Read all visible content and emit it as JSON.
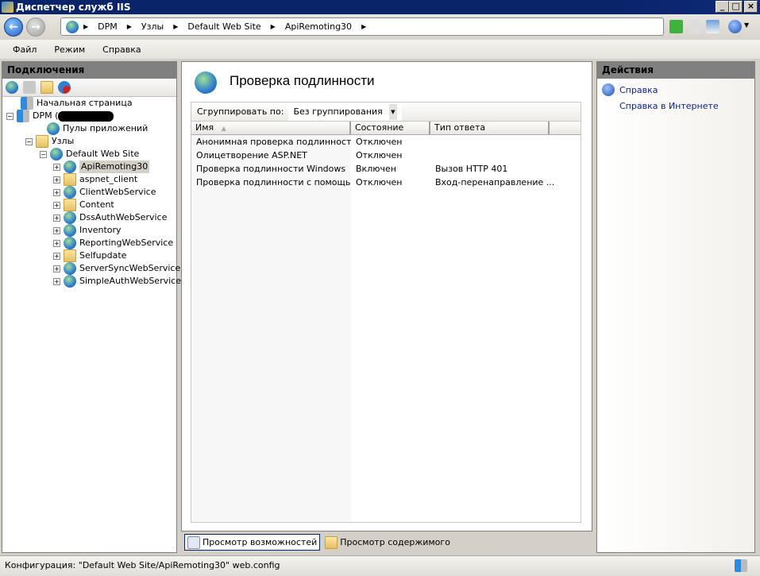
{
  "window": {
    "title": "Диспетчер служб IIS",
    "min": "_",
    "max": "□",
    "close": "×"
  },
  "address": {
    "crumbs": [
      "DPM",
      "Узлы",
      "Default Web Site",
      "ApiRemoting30"
    ],
    "sep": "▶"
  },
  "menu": [
    "Файл",
    "Режим",
    "Справка"
  ],
  "connections": {
    "title": "Подключения",
    "tree": [
      {
        "label": "Начальная страница",
        "icon": "home-server-icon"
      },
      {
        "label": "DPM (",
        "icon": "server-icon"
      },
      {
        "label": "Пулы приложений",
        "icon": "app-pools-icon"
      },
      {
        "label": "Узлы",
        "icon": "sites-folder-icon"
      },
      {
        "label": "Default Web Site",
        "icon": "globe-icon"
      },
      {
        "label": "ApiRemoting30",
        "icon": "web-app-icon"
      },
      {
        "label": "aspnet_client",
        "icon": "folder-icon"
      },
      {
        "label": "ClientWebService",
        "icon": "web-app-icon"
      },
      {
        "label": "Content",
        "icon": "virtual-dir-icon"
      },
      {
        "label": "DssAuthWebService",
        "icon": "web-app-icon"
      },
      {
        "label": "Inventory",
        "icon": "web-app-icon"
      },
      {
        "label": "ReportingWebService",
        "icon": "web-app-icon"
      },
      {
        "label": "Selfupdate",
        "icon": "virtual-dir-icon"
      },
      {
        "label": "ServerSyncWebService",
        "icon": "web-app-icon"
      },
      {
        "label": "SimpleAuthWebService",
        "icon": "web-app-icon"
      }
    ]
  },
  "main": {
    "title": "Проверка подлинности",
    "group_label": "Сгруппировать по:",
    "group_value": "Без группирования",
    "columns": [
      "Имя",
      "Состояние",
      "Тип ответа"
    ],
    "rows": [
      [
        "Анонимная проверка подлинности",
        "Отключен",
        ""
      ],
      [
        "Олицетворение ASP.NET",
        "Отключен",
        ""
      ],
      [
        "Проверка подлинности Windows",
        "Включен",
        "Вызов HTTP 401"
      ],
      [
        "Проверка подлинности с помощью ...",
        "Отключен",
        "Вход-перенаправление ..."
      ]
    ],
    "tabs": [
      "Просмотр возможностей",
      "Просмотр содержимого"
    ]
  },
  "actions": {
    "title": "Действия",
    "items": [
      "Справка",
      "Справка в Интернете"
    ]
  },
  "status": "Конфигурация: \"Default Web Site/ApiRemoting30\" web.config"
}
